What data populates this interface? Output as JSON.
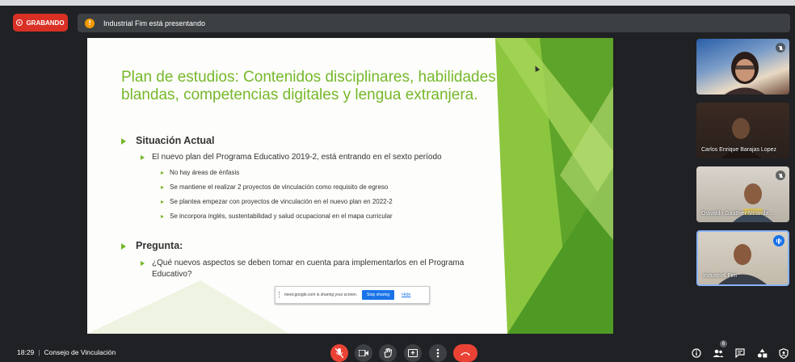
{
  "recording": {
    "label": "GRABANDO"
  },
  "presenting_banner": {
    "text": "Industrial Fim está presentando"
  },
  "slide": {
    "title": "Plan de estudios: Contenidos disciplinares, habilidades blandas, competencias digitales y lengua extranjera.",
    "section1": {
      "heading": "Situación Actual",
      "point": "El nuevo plan del Programa Educativo 2019-2, está entrando en el sexto período",
      "subpoints": [
        "No hay áreas de énfasis",
        "Se mantiene el realizar 2 proyectos de vinculación como requisito de egreso",
        "Se plantea empezar con proyectos de vinculación en el nuevo plan en 2022-2",
        "Se incorpora inglés, sustentabilidad y salud ocupacional en el mapa curricular"
      ]
    },
    "section2": {
      "heading": "Pregunta:",
      "point": "¿Qué nuevos aspectos se deben tomar en cuenta para implementarlos en el Programa Educativo?"
    },
    "share_bar": {
      "message": "meet.google.com is sharing your screen.",
      "stop_label": "Stop sharing",
      "hide_label": "Hide"
    },
    "accent_color": "#76b82a"
  },
  "participants": [
    {
      "name": "",
      "muted": true
    },
    {
      "name": "Carlos Enrique Barajas Lopez",
      "muted": false
    },
    {
      "name": "Oswaldo Gauthier Miranda ...",
      "muted": true
    },
    {
      "name": "Industrial Fim",
      "speaking": true
    }
  ],
  "bottom": {
    "time": "18:29",
    "separator": "|",
    "meeting_name": "Consejo de Vinculación",
    "participant_count": "6"
  }
}
